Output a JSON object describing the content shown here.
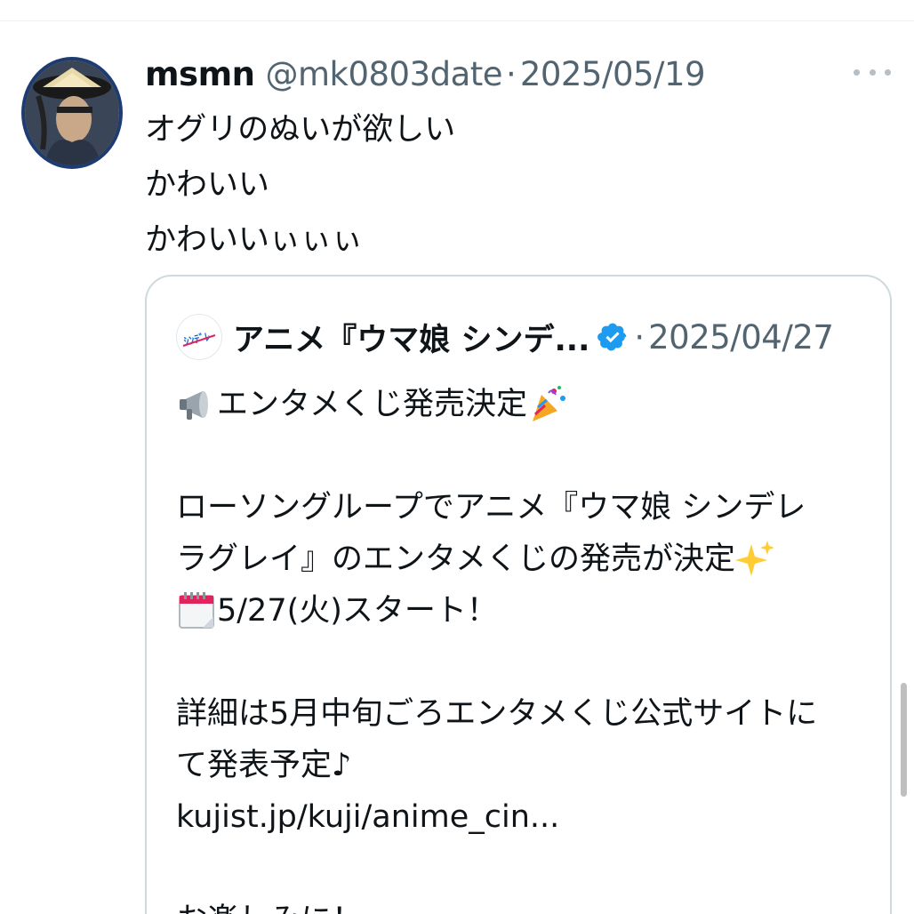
{
  "tweet": {
    "author_name": "msmn",
    "author_handle": "@mk0803date",
    "separator": "·",
    "date": "2025/05/19",
    "lines": [
      "オグリのぬいが欲しい",
      "かわいい",
      "かわいいぃぃぃ"
    ]
  },
  "quote": {
    "author_name": "アニメ『ウマ娘 シンデ...",
    "separator": "·",
    "date": "2025/04/27",
    "line1": "エンタメくじ発売決定",
    "line2": "ローソングループでアニメ『ウマ娘 シンデレ",
    "line3": "ラグレイ』のエンタメくじの発売が決定",
    "line4": "5/27(火)スタート！",
    "line5": "詳細は5月中旬ごろエンタメくじ公式サイトに",
    "line6": "て発表予定♪",
    "link": "kujist.jp/kuji/anime_cin...",
    "line8": "お楽しみに！"
  },
  "icons": {
    "more": "more-horizontal-icon",
    "verified": "verified-badge-icon",
    "megaphone": "megaphone-icon",
    "party": "party-popper-icon",
    "sparkles": "sparkles-icon",
    "calendar": "calendar-icon"
  },
  "colors": {
    "text_primary": "#0f1419",
    "text_secondary": "#536471",
    "verified_blue": "#1d9bf0",
    "card_border": "#cfd9de"
  }
}
